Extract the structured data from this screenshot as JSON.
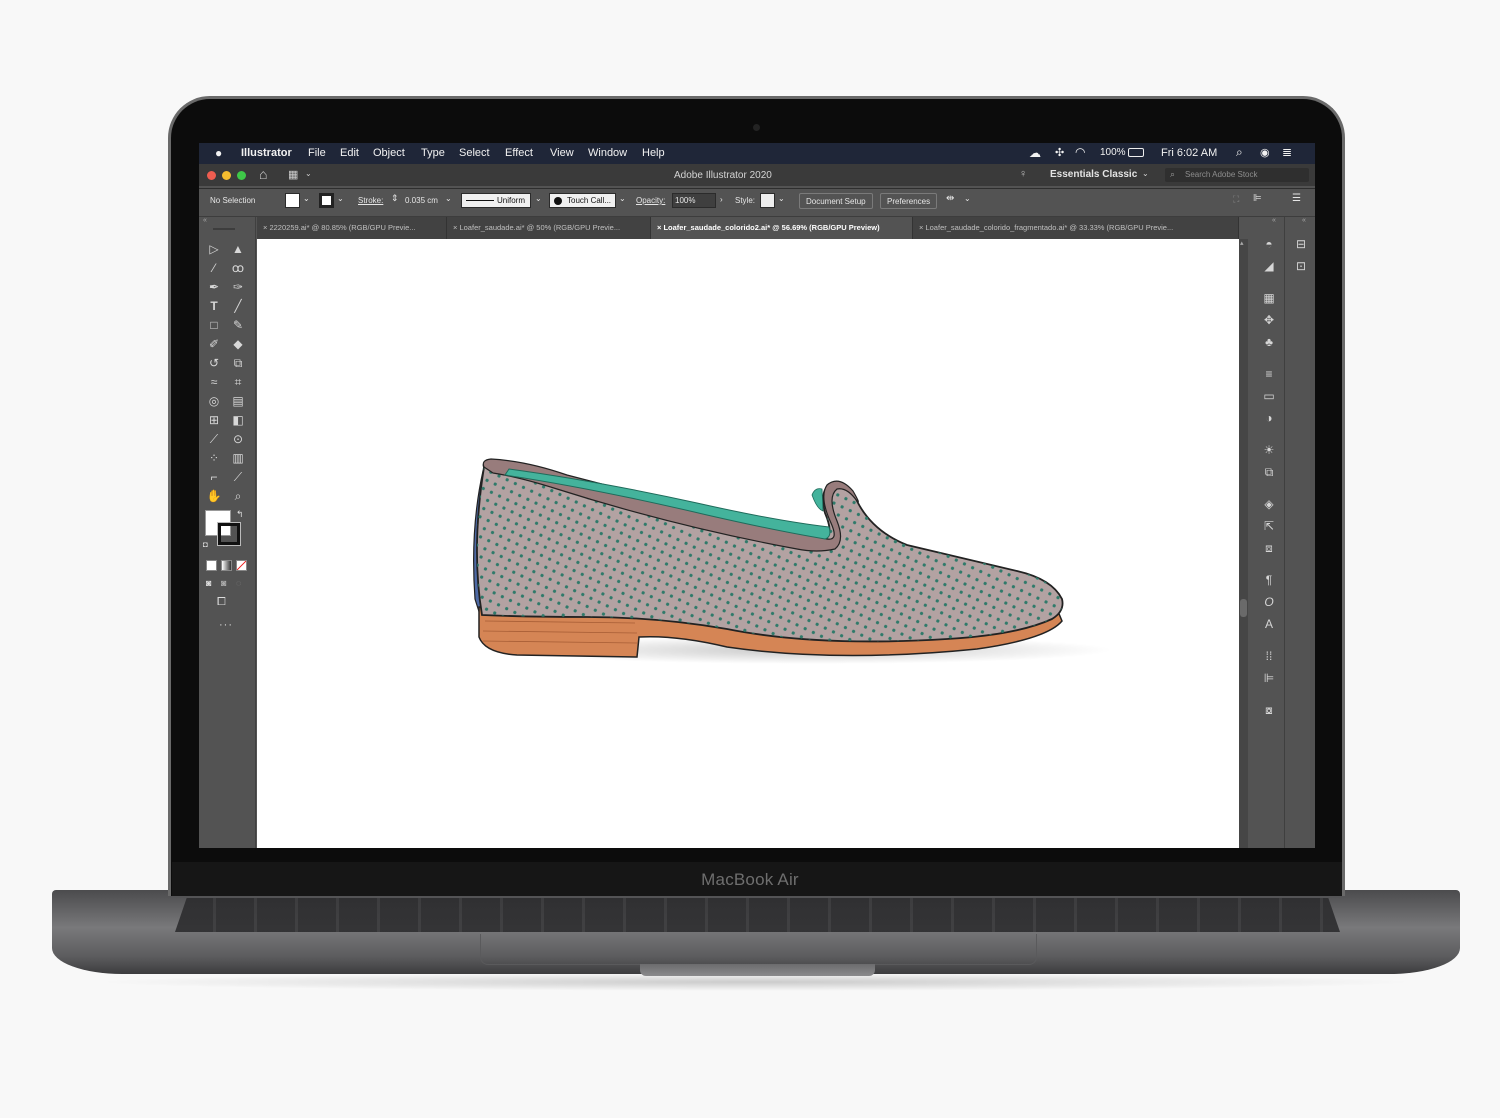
{
  "device": {
    "brand_label": "MacBook Air"
  },
  "menubar": {
    "app_name": "Illustrator",
    "menus": [
      "File",
      "Edit",
      "Object",
      "Type",
      "Select",
      "Effect",
      "View",
      "Window",
      "Help"
    ],
    "battery": "100%",
    "clock": "Fri 6:02 AM"
  },
  "titlebar": {
    "title": "Adobe Illustrator 2020",
    "workspace": "Essentials Classic",
    "search_placeholder": "Search Adobe Stock"
  },
  "control_bar": {
    "selection_status": "No Selection",
    "stroke_label": "Stroke:",
    "stroke_weight": "0.035 cm",
    "profile": "Uniform",
    "brush": "Touch Call...",
    "opacity_label": "Opacity:",
    "opacity_value": "100%",
    "style_label": "Style:",
    "document_setup": "Document Setup",
    "preferences": "Preferences"
  },
  "tabs": [
    {
      "label": "2220259.ai* @ 80.85% (RGB/GPU Previe...",
      "active": false
    },
    {
      "label": "Loafer_saudade.ai* @ 50% (RGB/GPU Previe...",
      "active": false
    },
    {
      "label": "Loafer_saudade_colorido2.ai* @ 56.69% (RGB/GPU Preview)",
      "active": true
    },
    {
      "label": "Loafer_saudade_colorido_fragmentado.ai* @ 33.33% (RGB/GPU Previe...",
      "active": false
    }
  ],
  "colors": {
    "menubar_bg": "#1f2638",
    "ui_panel": "#535353",
    "shoe_upper": "#b3a2a2",
    "shoe_dots": "#2f7a6a",
    "shoe_trim": "#987c7c",
    "lining_teal": "#44b39c",
    "sole": "#d58555",
    "heel_back": "#4e6aa5",
    "whatsapp": "#3fcf5a"
  }
}
